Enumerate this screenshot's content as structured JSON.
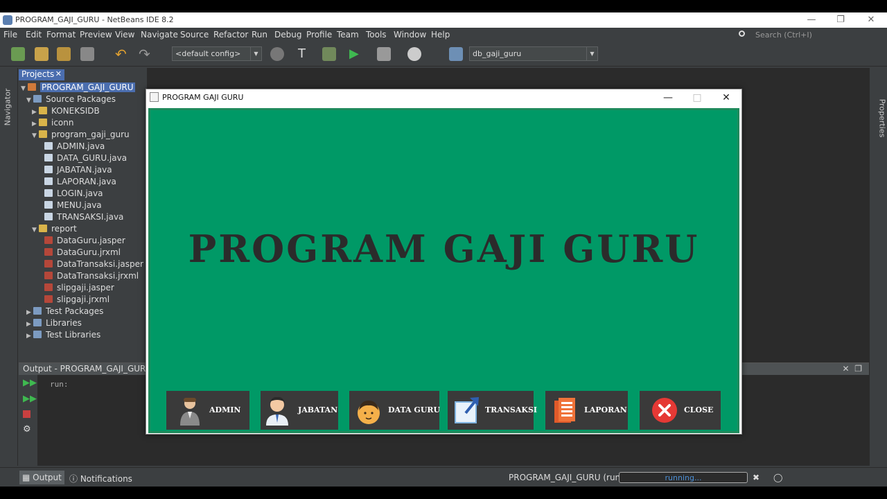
{
  "window": {
    "title": "PROGRAM_GAJI_GURU - NetBeans IDE 8.2"
  },
  "menu": [
    "File",
    "Edit",
    "Format",
    "Preview",
    "View",
    "Navigate",
    "Source",
    "Refactor",
    "Run",
    "Debug",
    "Profile",
    "Team",
    "Tools",
    "Window",
    "Help"
  ],
  "search": {
    "placeholder": "Search (Ctrl+I)"
  },
  "toolbar": {
    "config": "<default config>",
    "connection": "db_gaji_guru"
  },
  "side": {
    "navigator": "Navigator",
    "properties": "Properties"
  },
  "projects": {
    "tab": "Projects",
    "tree": [
      "PROGRAM_GAJI_GURU",
      "Source Packages",
      "KONEKSIDB",
      "iconn",
      "program_gaji_guru",
      "ADMIN.java",
      "DATA_GURU.java",
      "JABATAN.java",
      "LAPORAN.java",
      "LOGIN.java",
      "MENU.java",
      "TRANSAKSI.java",
      "report",
      "DataGuru.jasper",
      "DataGuru.jrxml",
      "DataTransaksi.jasper",
      "DataTransaksi.jrxml",
      "slipgaji.jasper",
      "slipgaji.jrxml",
      "Test Packages",
      "Libraries",
      "Test Libraries"
    ]
  },
  "output": {
    "title": "Output - PROGRAM_GAJI_GURU (",
    "text": "run:"
  },
  "status": {
    "output_tab": "Output",
    "notifications_tab": "Notifications",
    "task": "PROGRAM_GAJI_GURU (run)",
    "progress_text": "running..."
  },
  "app": {
    "title": "PROGRAM GAJI GURU",
    "heading": "PROGRAM GAJI GURU",
    "buttons": [
      "ADMIN",
      "JABATAN",
      "DATA GURU",
      "TRANSAKSI",
      "LAPORAN",
      "CLOSE"
    ]
  },
  "colors": {
    "app_bg": "#009966",
    "button_bg": "#3a3a3a",
    "ide_bg": "#3c3f41",
    "selection": "#4b6eaf"
  }
}
